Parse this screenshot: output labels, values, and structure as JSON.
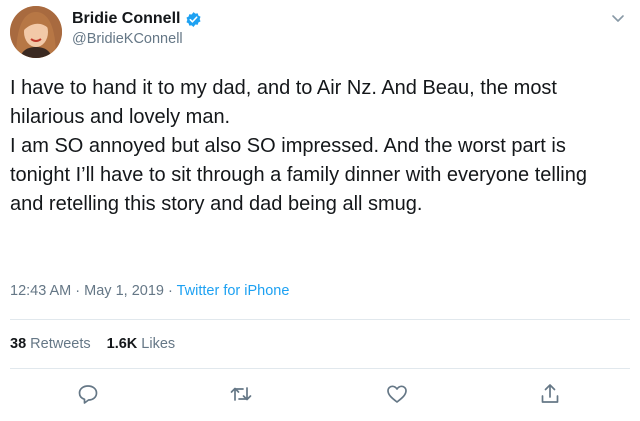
{
  "author": {
    "display_name": "Bridie Connell",
    "handle": "@BridieKConnell",
    "verified": true
  },
  "tweet": {
    "paragraphs": [
      "I have to hand it to my dad, and to Air Nz. And Beau, the most hilarious and lovely man.",
      "I am SO annoyed but also SO impressed. And the worst part is tonight I’ll have to sit through a family dinner with everyone telling and retelling this story and dad being all smug."
    ]
  },
  "meta": {
    "time": "12:43 AM",
    "separator": " · ",
    "date": "May 1, 2019",
    "source": "Twitter for iPhone"
  },
  "stats": {
    "retweets_count": "38",
    "retweets_label": "Retweets",
    "likes_count": "1.6K",
    "likes_label": "Likes"
  },
  "colors": {
    "accent": "#1da1f2",
    "secondary_text": "#657786",
    "primary_text": "#14171a",
    "divider": "#e1e8ed"
  },
  "icons": {
    "verified": "verified-badge-icon",
    "menu": "chevron-down-icon",
    "reply": "reply-icon",
    "retweet": "retweet-icon",
    "like": "heart-icon",
    "share": "share-icon"
  }
}
